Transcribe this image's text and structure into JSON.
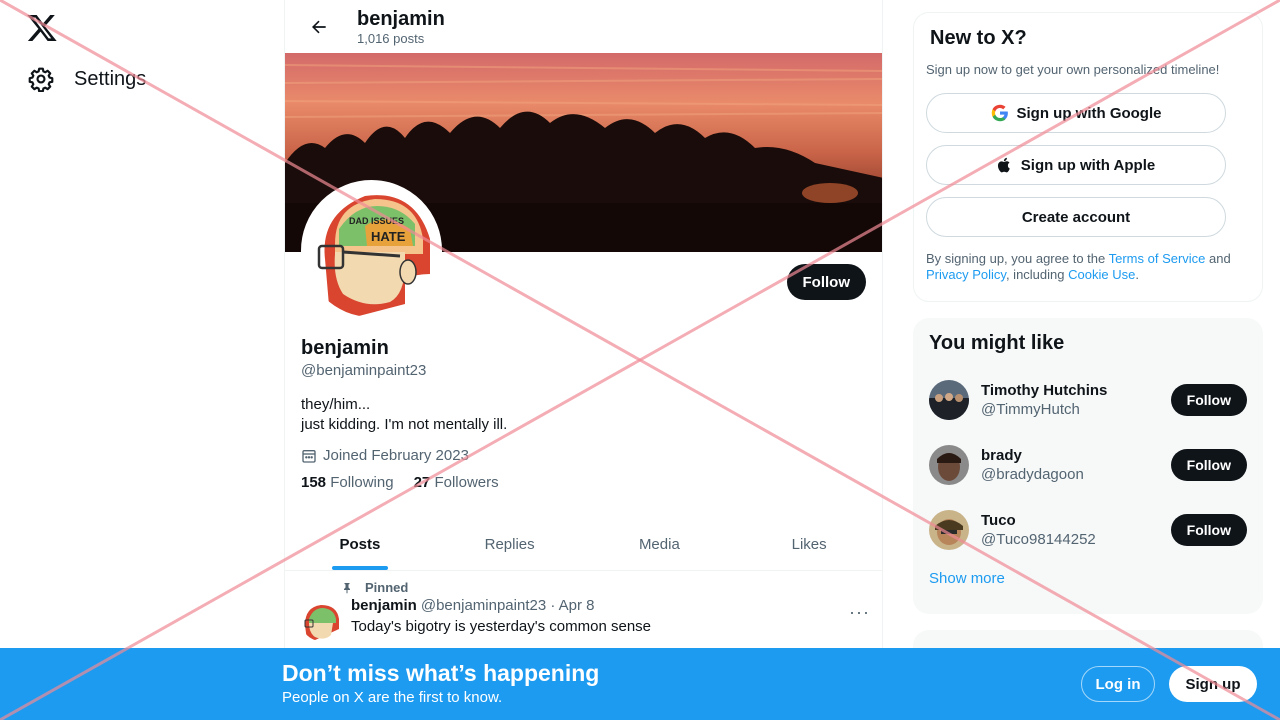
{
  "nav": {
    "settings_label": "Settings"
  },
  "topbar": {
    "name": "benjamin",
    "post_count": "1,016 posts"
  },
  "profile": {
    "display_name": "benjamin",
    "handle": "@benjaminpaint23",
    "bio_line1": "they/him...",
    "bio_line2": "just kidding. I'm not mentally ill.",
    "joined": "Joined February 2023",
    "following_count": "158",
    "following_label": "Following",
    "followers_count": "27",
    "followers_label": "Followers",
    "follow_label": "Follow",
    "avatar_words": [
      "DAD ISSUES",
      "HATE"
    ]
  },
  "tabs": [
    {
      "label": "Posts",
      "active": true
    },
    {
      "label": "Replies",
      "active": false
    },
    {
      "label": "Media",
      "active": false
    },
    {
      "label": "Likes",
      "active": false
    }
  ],
  "post": {
    "pinned_label": "Pinned",
    "name": "benjamin",
    "handle_date": "@benjaminpaint23 · Apr 8",
    "text": "Today's bigotry is yesterday's common sense"
  },
  "new_to_x": {
    "title": "New to X?",
    "subtitle": "Sign up now to get your own personalized timeline!",
    "google_label": "Sign up with Google",
    "apple_label": "Sign up with Apple",
    "create_label": "Create account",
    "terms_prefix": "By signing up, you agree to the ",
    "terms_link": "Terms of Service",
    "terms_and": " and ",
    "privacy_link": "Privacy Policy",
    "terms_including": ", including ",
    "cookie_link": "Cookie Use",
    "terms_end": "."
  },
  "you_might_like": {
    "title": "You might like",
    "users": [
      {
        "name": "Timothy Hutchins",
        "handle": "@TimmyHutch",
        "follow": "Follow"
      },
      {
        "name": "brady",
        "handle": "@bradydagoon",
        "follow": "Follow"
      },
      {
        "name": "Tuco",
        "handle": "@Tuco98144252",
        "follow": "Follow"
      }
    ],
    "show_more": "Show more"
  },
  "bottom_banner": {
    "title": "Don’t miss what’s happening",
    "subtitle": "People on X are the first to know.",
    "login_label": "Log in",
    "signup_label": "Sign up"
  },
  "colors": {
    "accent": "#1d9bf0",
    "text": "#0f1419",
    "muted": "#536471",
    "overlay": "#f5a0a8"
  }
}
